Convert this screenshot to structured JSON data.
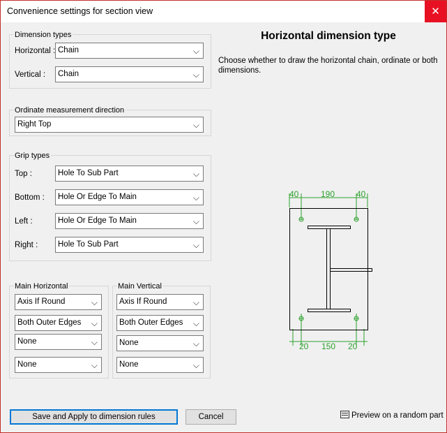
{
  "window": {
    "title": "Convenience settings for section view",
    "close_glyph": "✕"
  },
  "dimension_types": {
    "legend": "Dimension types",
    "horizontal_label": "Horizontal :",
    "horizontal_value": "Chain",
    "vertical_label": "Vertical :",
    "vertical_value": "Chain"
  },
  "ordinate": {
    "legend": "Ordinate measurement direction",
    "value": "Right Top"
  },
  "grip_types": {
    "legend": "Grip types",
    "top_label": "Top :",
    "top_value": "Hole To Sub Part",
    "bottom_label": "Bottom :",
    "bottom_value": "Hole Or Edge To Main",
    "left_label": "Left :",
    "left_value": "Hole Or Edge To Main",
    "right_label": "Right :",
    "right_value": "Hole To Sub Part"
  },
  "main_horizontal": {
    "legend": "Main Horizontal",
    "values": [
      "Axis If Round",
      "Both Outer Edges",
      "None",
      "None"
    ]
  },
  "main_vertical": {
    "legend": "Main Vertical",
    "values": [
      "Axis If Round",
      "Both Outer Edges",
      "None",
      "None"
    ]
  },
  "help": {
    "heading": "Horizontal dimension type",
    "description": "Choose whether to draw the horizontal chain, ordinate or both dimensions."
  },
  "diagram": {
    "top_dims": [
      "40",
      "190",
      "40"
    ],
    "bottom_dims": [
      "20",
      "150",
      "20"
    ],
    "dim_color": "#2ca02c"
  },
  "buttons": {
    "save": "Save and Apply to dimension rules",
    "cancel": "Cancel",
    "preview": "Preview on a random part"
  },
  "icons": {
    "dropdown": "chevron-down-icon",
    "close": "close-icon",
    "preview": "preview-window-icon"
  }
}
